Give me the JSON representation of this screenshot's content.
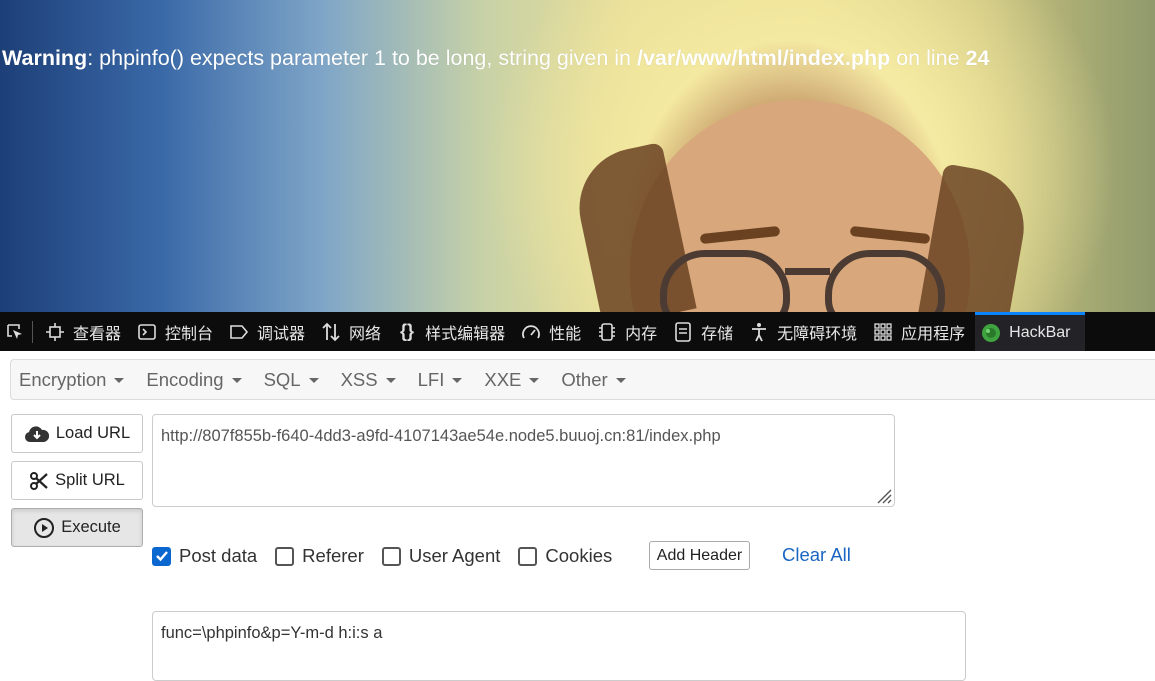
{
  "page": {
    "warning_label": "Warning",
    "warning_message": ": phpinfo() expects parameter 1 to be long, string given in ",
    "warning_path": "/var/www/html/index.php",
    "warning_online": " on line ",
    "warning_line": "24"
  },
  "devtools": {
    "tabs": [
      {
        "label": "查看器",
        "icon": "inspector-icon"
      },
      {
        "label": "控制台",
        "icon": "console-icon"
      },
      {
        "label": "调试器",
        "icon": "debugger-icon"
      },
      {
        "label": "网络",
        "icon": "network-icon"
      },
      {
        "label": "样式编辑器",
        "icon": "style-editor-icon"
      },
      {
        "label": "性能",
        "icon": "performance-icon"
      },
      {
        "label": "内存",
        "icon": "memory-icon"
      },
      {
        "label": "存储",
        "icon": "storage-icon"
      },
      {
        "label": "无障碍环境",
        "icon": "accessibility-icon"
      },
      {
        "label": "应用程序",
        "icon": "application-icon"
      },
      {
        "label": "HackBar",
        "icon": "hackbar-icon",
        "active": true
      }
    ]
  },
  "hackbar": {
    "menu": [
      "Encryption",
      "Encoding",
      "SQL",
      "XSS",
      "LFI",
      "XXE",
      "Other"
    ],
    "load_url": "Load URL",
    "split_url": "Split URL",
    "execute": "Execute",
    "url_value": "http://807f855b-f640-4dd3-a9fd-4107143ae54e.node5.buuoj.cn:81/index.php",
    "options": {
      "post_data": "Post data",
      "referer": "Referer",
      "user_agent": "User Agent",
      "cookies": "Cookies"
    },
    "post_data_checked": true,
    "add_header": "Add Header",
    "clear_all": "Clear All",
    "post_value": "func=\\phpinfo&p=Y-m-d h:i:s a"
  },
  "colors": {
    "accent": "#0b67d0",
    "toolbar_bg": "#0c0c0d",
    "link": "#1a66c2"
  }
}
